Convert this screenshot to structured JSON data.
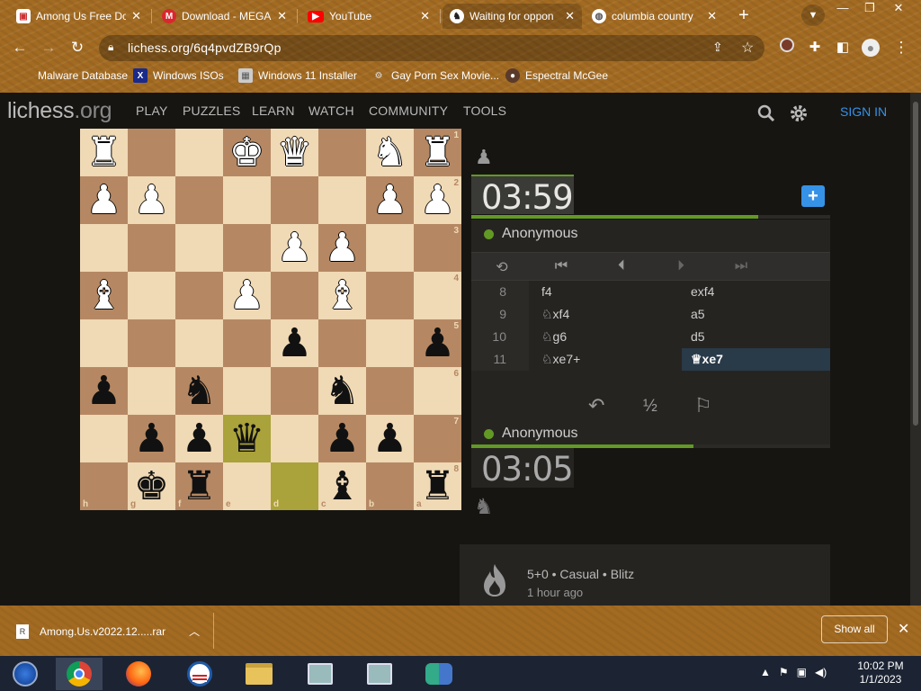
{
  "browser": {
    "tabs": [
      {
        "title": "Among Us Free Dow",
        "favicon": "gamebanana-icon"
      },
      {
        "title": "Download - MEGA",
        "favicon": "mega-icon"
      },
      {
        "title": "YouTube",
        "favicon": "youtube-icon"
      },
      {
        "title": "Waiting for oppon",
        "favicon": "lichess-icon"
      },
      {
        "title": "columbia country",
        "favicon": "globe-icon"
      }
    ],
    "url": "lichess.org/6q4pvdZB9rQp",
    "bookmarks": [
      {
        "label": "Malware Database"
      },
      {
        "label": "Windows ISOs"
      },
      {
        "label": "Windows 11 Installer"
      },
      {
        "label": "Gay Porn Sex Movie..."
      },
      {
        "label": "Espectral McGee"
      }
    ]
  },
  "site": {
    "logo_main": "lichess",
    "logo_tld": ".org",
    "nav": [
      "PLAY",
      "PUZZLES",
      "LEARN",
      "WATCH",
      "COMMUNITY",
      "TOOLS"
    ],
    "sign_in": "SIGN IN"
  },
  "board": {
    "orientation": "black",
    "ranks": [
      "1",
      "2",
      "3",
      "4",
      "5",
      "6",
      "7",
      "8"
    ],
    "files": [
      "h",
      "g",
      "f",
      "e",
      "d",
      "c",
      "b",
      "a"
    ],
    "rows": [
      [
        "wR",
        "",
        "",
        "wK",
        "wQ",
        "",
        "wN",
        "wR"
      ],
      [
        "wP",
        "wP",
        "",
        "",
        "",
        "",
        "wP",
        "wP"
      ],
      [
        "",
        "",
        "",
        "",
        "wP",
        "wP",
        "",
        ""
      ],
      [
        "wB",
        "",
        "",
        "wP",
        "",
        "wB",
        "",
        ""
      ],
      [
        "",
        "",
        "",
        "",
        "bP",
        "",
        "",
        "bP"
      ],
      [
        "bP",
        "",
        "bN",
        "",
        "",
        "bN",
        "",
        ""
      ],
      [
        "",
        "bP",
        "bP",
        "bQ",
        "",
        "bP",
        "bP",
        ""
      ],
      [
        "",
        "bK",
        "bR",
        "",
        "",
        "bB",
        "",
        "bR"
      ]
    ],
    "highlight": [
      [
        6,
        3
      ],
      [
        7,
        4
      ]
    ]
  },
  "game": {
    "top_player": {
      "name": "Anonymous",
      "clock": "03:59",
      "online": true,
      "time_fraction": 0.8
    },
    "bottom_player": {
      "name": "Anonymous",
      "clock": "03:05",
      "online": true,
      "time_fraction": 0.62
    },
    "moves": [
      {
        "num": "8",
        "white": "f4",
        "black": "exf4"
      },
      {
        "num": "9",
        "white": "♘xf4",
        "black": "a5"
      },
      {
        "num": "10",
        "white": "♘g6",
        "black": "d5"
      },
      {
        "num": "11",
        "white": "♘xe7+",
        "black": "♕xe7"
      }
    ],
    "draw_label": "½",
    "info_type": "5+0 • Casual • Blitz",
    "info_time": "1 hour ago"
  },
  "download": {
    "file": "Among.Us.v2022.12.....rar",
    "show_all": "Show all"
  },
  "taskbar": {
    "time": "10:02 PM",
    "date": "1/1/2023"
  },
  "colors": {
    "accent": "#629924",
    "link": "#3692e7",
    "chrome": "#a36b22"
  }
}
